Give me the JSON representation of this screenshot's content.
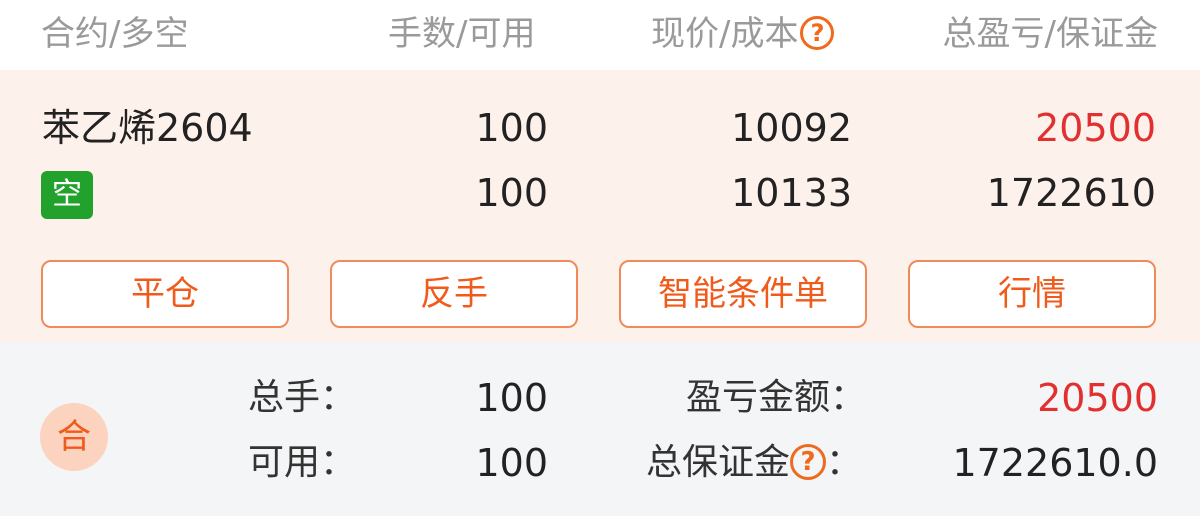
{
  "colors": {
    "accent": "#f05a1a",
    "profit_red": "#e23030",
    "short_green": "#22a12c",
    "position_bg": "#fdf1ec",
    "summary_bg": "#f4f5f7"
  },
  "header": {
    "col1": "合约/多空",
    "col2": "手数/可用",
    "col3": "现价/成本",
    "col3_help": "?",
    "col4": "总盈亏/保证金"
  },
  "position": {
    "contract": "苯乙烯2604",
    "direction": "空",
    "lots": "100",
    "available": "100",
    "current_price": "10092",
    "cost": "10133",
    "total_pnl": "20500",
    "margin": "1722610"
  },
  "actions": {
    "close": "平仓",
    "reverse": "反手",
    "smart_order": "智能条件单",
    "market": "行情"
  },
  "summary": {
    "badge": "合",
    "total_lots_label": "总手：",
    "total_lots": "100",
    "available_label": "可用：",
    "available": "100",
    "pnl_label": "盈亏金额：",
    "pnl": "20500",
    "margin_label": "总保证金",
    "margin_help": "?",
    "margin_colon": "：",
    "margin": "1722610.0"
  }
}
